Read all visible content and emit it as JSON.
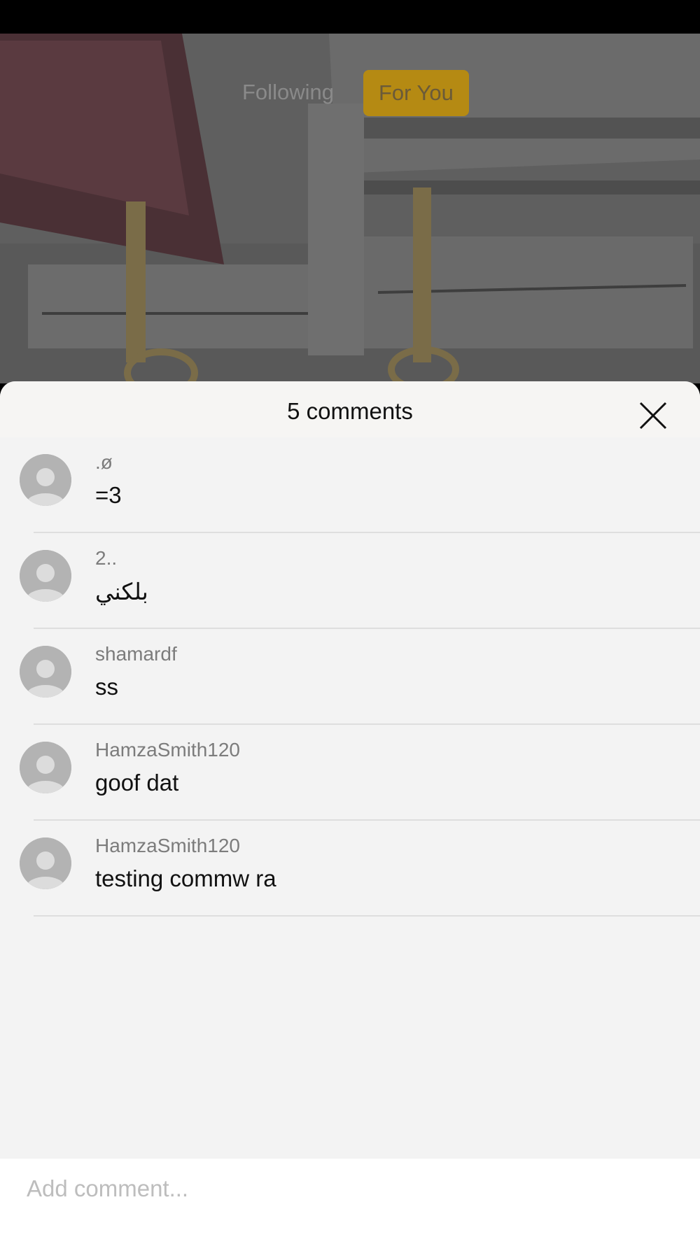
{
  "top_nav": {
    "following_label": "Following",
    "for_you_label": "For You",
    "accent_color": "#b58a13"
  },
  "comments_sheet": {
    "title": "5 comments",
    "close_icon": "close-icon",
    "comments": [
      {
        "username": ".ø",
        "text": "=3"
      },
      {
        "username": "2..",
        "text": "بلكني"
      },
      {
        "username": "shamardf",
        "text": "ss"
      },
      {
        "username": "HamzaSmith120",
        "text": "goof dat"
      },
      {
        "username": "HamzaSmith120",
        "text": "testing commw ra"
      }
    ]
  },
  "comment_input": {
    "placeholder": "Add comment..."
  }
}
